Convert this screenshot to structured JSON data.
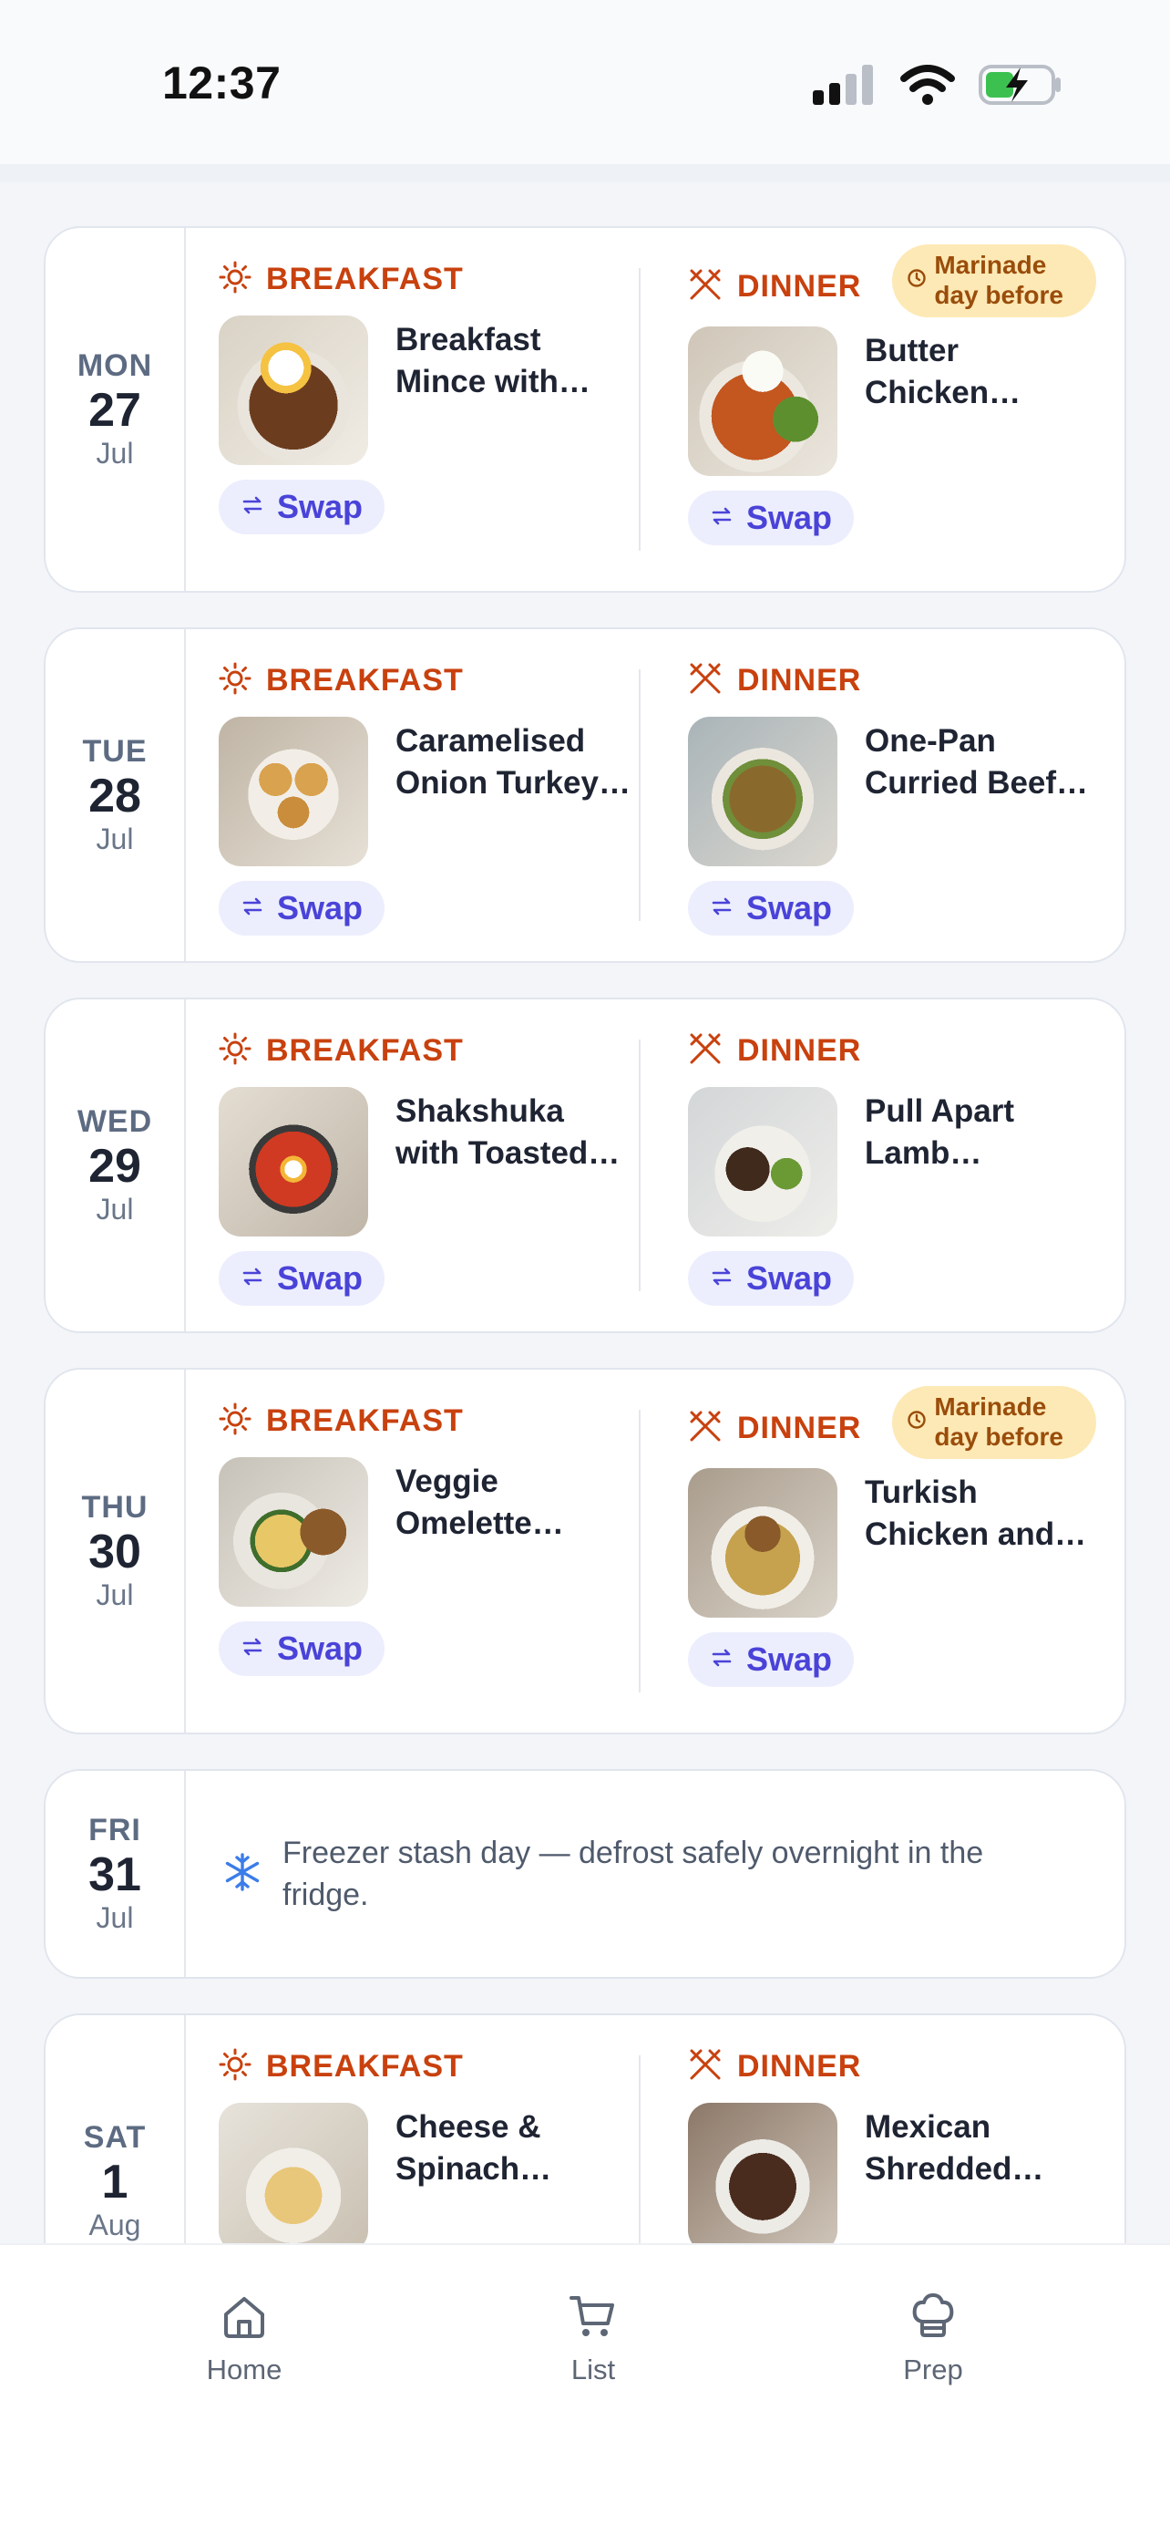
{
  "status": {
    "time": "12:37"
  },
  "days": [
    {
      "dow": "MON",
      "day": "27",
      "month": "Jul",
      "breakfast": {
        "label": "BREAKFAST",
        "name": "Breakfast Mince with…",
        "swap": "Swap"
      },
      "dinner": {
        "label": "DINNER",
        "badge": "Marinade day before",
        "name": "Butter Chicken…",
        "swap": "Swap"
      }
    },
    {
      "dow": "TUE",
      "day": "28",
      "month": "Jul",
      "breakfast": {
        "label": "BREAKFAST",
        "name": "Caramelised Onion Turkey…",
        "swap": "Swap"
      },
      "dinner": {
        "label": "DINNER",
        "name": "One-Pan Curried Beef…",
        "swap": "Swap"
      }
    },
    {
      "dow": "WED",
      "day": "29",
      "month": "Jul",
      "breakfast": {
        "label": "BREAKFAST",
        "name": "Shakshuka with Toasted…",
        "swap": "Swap"
      },
      "dinner": {
        "label": "DINNER",
        "name": "Pull Apart Lamb…",
        "swap": "Swap"
      }
    },
    {
      "dow": "THU",
      "day": "30",
      "month": "Jul",
      "breakfast": {
        "label": "BREAKFAST",
        "name": "Veggie Omelette…",
        "swap": "Swap"
      },
      "dinner": {
        "label": "DINNER",
        "badge": "Marinade day before",
        "name": "Turkish Chicken and…",
        "swap": "Swap"
      }
    },
    {
      "dow": "FRI",
      "day": "31",
      "month": "Jul",
      "note": "Freezer stash day — defrost safely overnight in the fridge."
    },
    {
      "dow": "SAT",
      "day": "1",
      "month": "Aug",
      "breakfast": {
        "label": "BREAKFAST",
        "name": "Cheese & Spinach…"
      },
      "dinner": {
        "label": "DINNER",
        "name": "Mexican Shredded…"
      }
    }
  ],
  "tabs": {
    "home": "Home",
    "list": "List",
    "prep": "Prep"
  },
  "colors": {
    "accent": "#c8410e",
    "swap": "#4a43d8",
    "badge_bg": "#fde9b5"
  }
}
